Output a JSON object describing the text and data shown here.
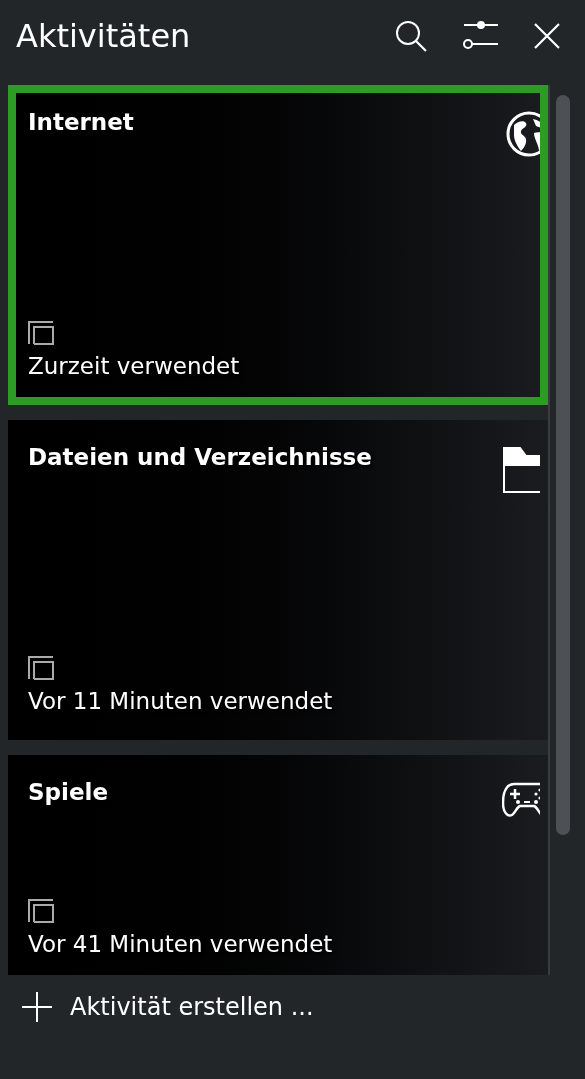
{
  "header": {
    "title": "Aktivitäten"
  },
  "activities": [
    {
      "name": "Internet",
      "kind": "globe",
      "status": "Zurzeit verwendet",
      "selected": true
    },
    {
      "name": "Dateien und Verzeichnisse",
      "kind": "folder",
      "status": "Vor 11 Minuten verwendet",
      "selected": false
    },
    {
      "name": "Spiele",
      "kind": "gamepad",
      "status": "Vor 41 Minuten verwendet",
      "selected": false
    }
  ],
  "create_button": {
    "label": "Aktivität erstellen ..."
  }
}
